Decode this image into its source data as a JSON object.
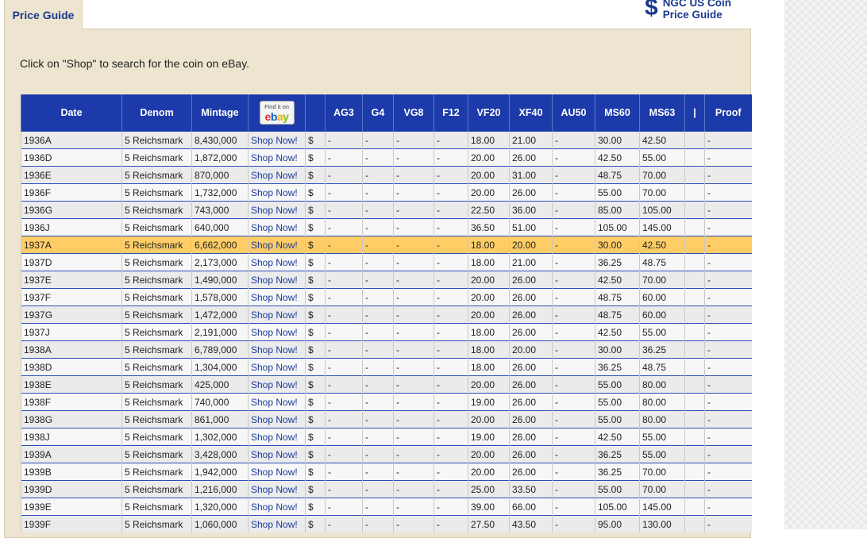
{
  "tab_label": "Price Guide",
  "logo": {
    "symbol": "$",
    "line1": "NGC US Coin",
    "line2": "Price Guide"
  },
  "instruction": "Click on \"Shop\" to search for the coin on eBay.",
  "ebay_badge": {
    "text": "Find it on",
    "letters": [
      "e",
      "b",
      "a",
      "y"
    ],
    "colors": [
      "#e53238",
      "#0064d2",
      "#f5af02",
      "#86b817"
    ]
  },
  "columns": [
    "Date",
    "Denom",
    "Mintage",
    "",
    "",
    "AG3",
    "G4",
    "VG8",
    "F12",
    "VF20",
    "XF40",
    "AU50",
    "MS60",
    "MS63",
    "|",
    "Proof"
  ],
  "shop_label": "Shop Now!",
  "currency": "$",
  "highlight_color": "#fecd66",
  "header_color": "#1c3aa9",
  "rows": [
    {
      "date": "1936A",
      "denom": "5 Reichsmark",
      "mintage": "8,430,000",
      "ag3": "-",
      "g4": "-",
      "vg8": "-",
      "f12": "-",
      "vf20": "18.00",
      "xf40": "21.00",
      "au50": "-",
      "ms60": "30.00",
      "ms63": "42.50",
      "sep": "",
      "proof": "-"
    },
    {
      "date": "1936D",
      "denom": "5 Reichsmark",
      "mintage": "1,872,000",
      "ag3": "-",
      "g4": "-",
      "vg8": "-",
      "f12": "-",
      "vf20": "20.00",
      "xf40": "26.00",
      "au50": "-",
      "ms60": "42.50",
      "ms63": "55.00",
      "sep": "",
      "proof": "-"
    },
    {
      "date": "1936E",
      "denom": "5 Reichsmark",
      "mintage": "870,000",
      "ag3": "-",
      "g4": "-",
      "vg8": "-",
      "f12": "-",
      "vf20": "20.00",
      "xf40": "31.00",
      "au50": "-",
      "ms60": "48.75",
      "ms63": "70.00",
      "sep": "",
      "proof": "-"
    },
    {
      "date": "1936F",
      "denom": "5 Reichsmark",
      "mintage": "1,732,000",
      "ag3": "-",
      "g4": "-",
      "vg8": "-",
      "f12": "-",
      "vf20": "20.00",
      "xf40": "26.00",
      "au50": "-",
      "ms60": "55.00",
      "ms63": "70.00",
      "sep": "",
      "proof": "-"
    },
    {
      "date": "1936G",
      "denom": "5 Reichsmark",
      "mintage": "743,000",
      "ag3": "-",
      "g4": "-",
      "vg8": "-",
      "f12": "-",
      "vf20": "22.50",
      "xf40": "36.00",
      "au50": "-",
      "ms60": "85.00",
      "ms63": "105.00",
      "sep": "",
      "proof": "-"
    },
    {
      "date": "1936J",
      "denom": "5 Reichsmark",
      "mintage": "640,000",
      "ag3": "-",
      "g4": "-",
      "vg8": "-",
      "f12": "-",
      "vf20": "36.50",
      "xf40": "51.00",
      "au50": "-",
      "ms60": "105.00",
      "ms63": "145.00",
      "sep": "",
      "proof": "-"
    },
    {
      "date": "1937A",
      "denom": "5 Reichsmark",
      "mintage": "6,662,000",
      "ag3": "-",
      "g4": "-",
      "vg8": "-",
      "f12": "-",
      "vf20": "18.00",
      "xf40": "20.00",
      "au50": "-",
      "ms60": "30.00",
      "ms63": "42.50",
      "sep": "",
      "proof": "-",
      "highlight": true
    },
    {
      "date": "1937D",
      "denom": "5 Reichsmark",
      "mintage": "2,173,000",
      "ag3": "-",
      "g4": "-",
      "vg8": "-",
      "f12": "-",
      "vf20": "18.00",
      "xf40": "21.00",
      "au50": "-",
      "ms60": "36.25",
      "ms63": "48.75",
      "sep": "",
      "proof": "-"
    },
    {
      "date": "1937E",
      "denom": "5 Reichsmark",
      "mintage": "1,490,000",
      "ag3": "-",
      "g4": "-",
      "vg8": "-",
      "f12": "-",
      "vf20": "20.00",
      "xf40": "26.00",
      "au50": "-",
      "ms60": "42.50",
      "ms63": "70.00",
      "sep": "",
      "proof": "-"
    },
    {
      "date": "1937F",
      "denom": "5 Reichsmark",
      "mintage": "1,578,000",
      "ag3": "-",
      "g4": "-",
      "vg8": "-",
      "f12": "-",
      "vf20": "20.00",
      "xf40": "26.00",
      "au50": "-",
      "ms60": "48.75",
      "ms63": "60.00",
      "sep": "",
      "proof": "-"
    },
    {
      "date": "1937G",
      "denom": "5 Reichsmark",
      "mintage": "1,472,000",
      "ag3": "-",
      "g4": "-",
      "vg8": "-",
      "f12": "-",
      "vf20": "20.00",
      "xf40": "26.00",
      "au50": "-",
      "ms60": "48.75",
      "ms63": "60.00",
      "sep": "",
      "proof": "-"
    },
    {
      "date": "1937J",
      "denom": "5 Reichsmark",
      "mintage": "2,191,000",
      "ag3": "-",
      "g4": "-",
      "vg8": "-",
      "f12": "-",
      "vf20": "18.00",
      "xf40": "26.00",
      "au50": "-",
      "ms60": "42.50",
      "ms63": "55.00",
      "sep": "",
      "proof": "-"
    },
    {
      "date": "1938A",
      "denom": "5 Reichsmark",
      "mintage": "6,789,000",
      "ag3": "-",
      "g4": "-",
      "vg8": "-",
      "f12": "-",
      "vf20": "18.00",
      "xf40": "20.00",
      "au50": "-",
      "ms60": "30.00",
      "ms63": "36.25",
      "sep": "",
      "proof": "-"
    },
    {
      "date": "1938D",
      "denom": "5 Reichsmark",
      "mintage": "1,304,000",
      "ag3": "-",
      "g4": "-",
      "vg8": "-",
      "f12": "-",
      "vf20": "18.00",
      "xf40": "26.00",
      "au50": "-",
      "ms60": "36.25",
      "ms63": "48.75",
      "sep": "",
      "proof": "-"
    },
    {
      "date": "1938E",
      "denom": "5 Reichsmark",
      "mintage": "425,000",
      "ag3": "-",
      "g4": "-",
      "vg8": "-",
      "f12": "-",
      "vf20": "20.00",
      "xf40": "26.00",
      "au50": "-",
      "ms60": "55.00",
      "ms63": "80.00",
      "sep": "",
      "proof": "-"
    },
    {
      "date": "1938F",
      "denom": "5 Reichsmark",
      "mintage": "740,000",
      "ag3": "-",
      "g4": "-",
      "vg8": "-",
      "f12": "-",
      "vf20": "19.00",
      "xf40": "26.00",
      "au50": "-",
      "ms60": "55.00",
      "ms63": "80.00",
      "sep": "",
      "proof": "-"
    },
    {
      "date": "1938G",
      "denom": "5 Reichsmark",
      "mintage": "861,000",
      "ag3": "-",
      "g4": "-",
      "vg8": "-",
      "f12": "-",
      "vf20": "20.00",
      "xf40": "26.00",
      "au50": "-",
      "ms60": "55.00",
      "ms63": "80.00",
      "sep": "",
      "proof": "-"
    },
    {
      "date": "1938J",
      "denom": "5 Reichsmark",
      "mintage": "1,302,000",
      "ag3": "-",
      "g4": "-",
      "vg8": "-",
      "f12": "-",
      "vf20": "19.00",
      "xf40": "26.00",
      "au50": "-",
      "ms60": "42.50",
      "ms63": "55.00",
      "sep": "",
      "proof": "-"
    },
    {
      "date": "1939A",
      "denom": "5 Reichsmark",
      "mintage": "3,428,000",
      "ag3": "-",
      "g4": "-",
      "vg8": "-",
      "f12": "-",
      "vf20": "20.00",
      "xf40": "26.00",
      "au50": "-",
      "ms60": "36.25",
      "ms63": "55.00",
      "sep": "",
      "proof": "-"
    },
    {
      "date": "1939B",
      "denom": "5 Reichsmark",
      "mintage": "1,942,000",
      "ag3": "-",
      "g4": "-",
      "vg8": "-",
      "f12": "-",
      "vf20": "20.00",
      "xf40": "26.00",
      "au50": "-",
      "ms60": "36.25",
      "ms63": "70.00",
      "sep": "",
      "proof": "-"
    },
    {
      "date": "1939D",
      "denom": "5 Reichsmark",
      "mintage": "1,216,000",
      "ag3": "-",
      "g4": "-",
      "vg8": "-",
      "f12": "-",
      "vf20": "25.00",
      "xf40": "33.50",
      "au50": "-",
      "ms60": "55.00",
      "ms63": "70.00",
      "sep": "",
      "proof": "-"
    },
    {
      "date": "1939E",
      "denom": "5 Reichsmark",
      "mintage": "1,320,000",
      "ag3": "-",
      "g4": "-",
      "vg8": "-",
      "f12": "-",
      "vf20": "39.00",
      "xf40": "66.00",
      "au50": "-",
      "ms60": "105.00",
      "ms63": "145.00",
      "sep": "",
      "proof": "-"
    },
    {
      "date": "1939F",
      "denom": "5 Reichsmark",
      "mintage": "1,060,000",
      "ag3": "-",
      "g4": "-",
      "vg8": "-",
      "f12": "-",
      "vf20": "27.50",
      "xf40": "43.50",
      "au50": "-",
      "ms60": "95.00",
      "ms63": "130.00",
      "sep": "",
      "proof": "-"
    }
  ]
}
